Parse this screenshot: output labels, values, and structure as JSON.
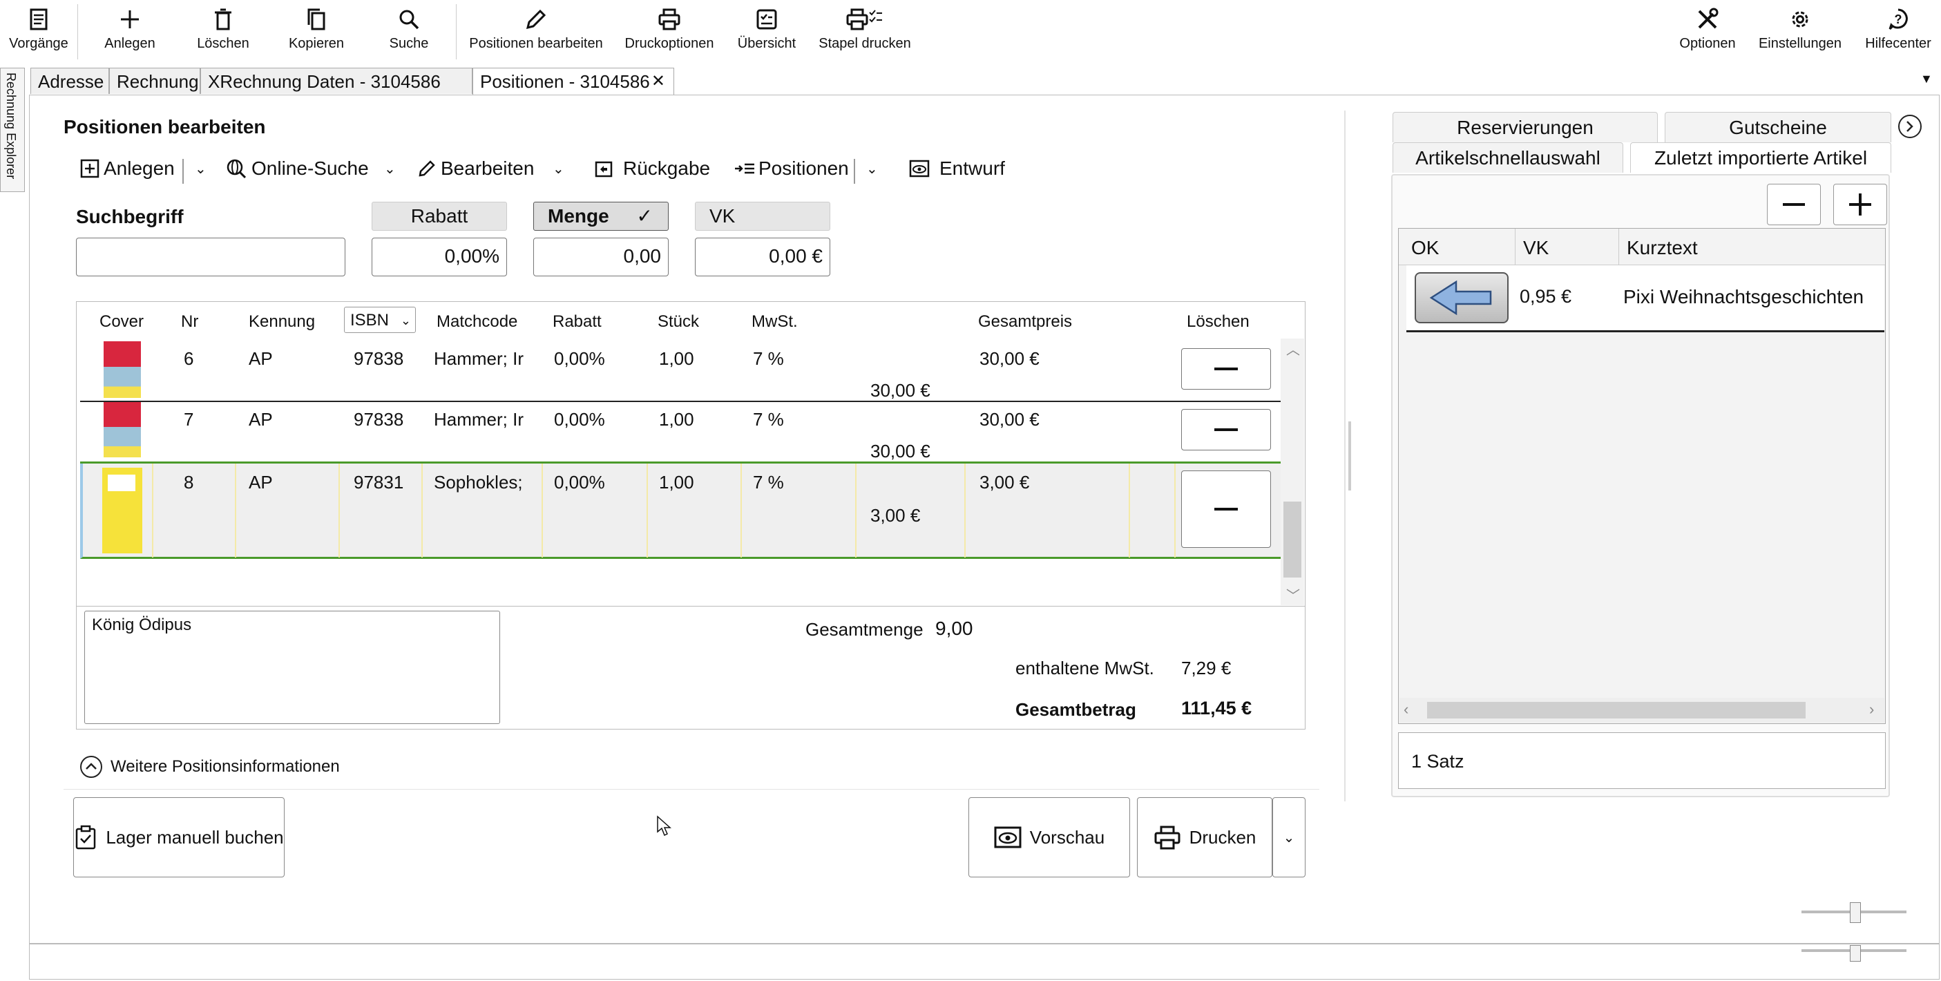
{
  "toolbar": {
    "items": [
      {
        "label": "Vorgänge",
        "icon": "document-list-icon"
      },
      {
        "label": "Anlegen",
        "icon": "plus-icon"
      },
      {
        "label": "Löschen",
        "icon": "trash-icon"
      },
      {
        "label": "Kopieren",
        "icon": "copy-icon"
      },
      {
        "label": "Suche",
        "icon": "search-icon"
      },
      {
        "label": "Positionen bearbeiten",
        "icon": "pencil-icon"
      },
      {
        "label": "Druckoptionen",
        "icon": "printer-icon"
      },
      {
        "label": "Übersicht",
        "icon": "checklist-icon"
      },
      {
        "label": "Stapel drucken",
        "icon": "batch-print-icon"
      }
    ],
    "right": [
      {
        "label": "Optionen",
        "icon": "tools-icon"
      },
      {
        "label": "Einstellungen",
        "icon": "gear-icon"
      },
      {
        "label": "Hilfecenter",
        "icon": "help-icon"
      }
    ]
  },
  "sidebar_label": "Rechnung Explorer",
  "tabs": [
    "Adresse",
    "Rechnung",
    "XRechnung Daten - 3104586",
    "Positionen - 3104586"
  ],
  "section_title": "Positionen bearbeiten",
  "subtoolbar": {
    "anlegen": "Anlegen",
    "online_suche": "Online-Suche",
    "bearbeiten": "Bearbeiten",
    "rueckgabe": "Rückgabe",
    "positionen": "Positionen",
    "entwurf": "Entwurf"
  },
  "search": {
    "label": "Suchbegriff",
    "value": "",
    "rabatt_label": "Rabatt",
    "rabatt_value": "0,00%",
    "menge_label": "Menge",
    "menge_value": "0,00",
    "vk_label": "VK",
    "vk_value": "0,00 €"
  },
  "table": {
    "headers": [
      "Cover",
      "Nr",
      "Kennung",
      "ISBN",
      "Matchcode",
      "Rabatt",
      "Stück",
      "MwSt.",
      "Gesamtpreis",
      "Löschen"
    ],
    "rows": [
      {
        "nr": "6",
        "kennung": "AP",
        "isbn": "97838",
        "matchcode": "Hammer; Ir",
        "rabatt": "0,00%",
        "stueck": "1,00",
        "mwst": "7 %",
        "einzelpreis": "30,00 €",
        "gesamtpreis": "30,00 €"
      },
      {
        "nr": "7",
        "kennung": "AP",
        "isbn": "97838",
        "matchcode": "Hammer; Ir",
        "rabatt": "0,00%",
        "stueck": "1,00",
        "mwst": "7 %",
        "einzelpreis": "30,00 €",
        "gesamtpreis": "30,00 €"
      },
      {
        "nr": "8",
        "kennung": "AP",
        "isbn": "97831",
        "matchcode": "Sophokles;",
        "rabatt": "0,00%",
        "stueck": "1,00",
        "mwst": "7 %",
        "einzelpreis": "3,00 €",
        "gesamtpreis": "3,00 €"
      }
    ]
  },
  "summary": {
    "title_text": "König Ödipus",
    "gesamtmenge_label": "Gesamtmenge",
    "gesamtmenge_value": "9,00",
    "mwst_label": "enthaltene MwSt.",
    "mwst_value": "7,29 €",
    "gesamtbetrag_label": "Gesamtbetrag",
    "gesamtbetrag_value": "111,45 €"
  },
  "weitere": "Weitere Positionsinformationen",
  "buttons": {
    "lager": "Lager manuell buchen",
    "vorschau": "Vorschau",
    "drucken": "Drucken"
  },
  "right_panel": {
    "tabs_top": [
      "Reservierungen",
      "Gutscheine"
    ],
    "tabs_bottom": [
      "Artikelschnellauswahl",
      "Zuletzt importierte Artikel"
    ],
    "headers": [
      "OK",
      "VK",
      "Kurztext"
    ],
    "rows": [
      {
        "vk": "0,95 €",
        "kurztext": "Pixi Weihnachtsgeschichten"
      }
    ],
    "footer": "1 Satz"
  }
}
